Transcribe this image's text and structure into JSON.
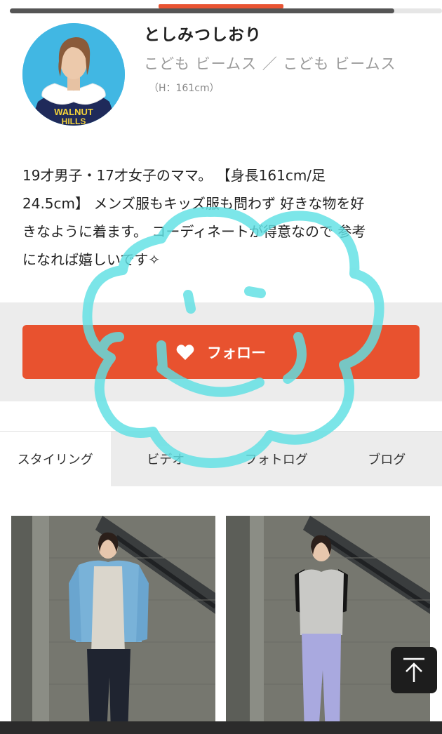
{
  "progress": {
    "fraction": 0.89,
    "accent_color": "#e95433"
  },
  "profile": {
    "name": "としみつしおり",
    "shop": "こども ビームス ／ こども ビームス",
    "height": "（H：161cm）",
    "avatar_shirt_text_1": "WALNUT",
    "avatar_shirt_text_2": "HILLS"
  },
  "bio": {
    "lines": [
      "19才男子・17才女子のママ。 【身長161cm/足",
      "24.5cm】 メンズ服もキッズ服も問わず 好きな物を好",
      "きなように着ます。 コーディネートが得意なので 参考",
      "になれば嬉しいです✧"
    ]
  },
  "follow": {
    "label": "フォロー",
    "icon": "heart-icon",
    "color": "#e8522f"
  },
  "tabs": [
    {
      "label": "スタイリング",
      "active": true
    },
    {
      "label": "ビデオ",
      "active": false
    },
    {
      "label": "フォトログ",
      "active": false
    },
    {
      "label": "ブログ",
      "active": false
    }
  ],
  "photos": [
    {
      "name": "styling-photo-1"
    },
    {
      "name": "styling-photo-2"
    }
  ],
  "scroll_top": {
    "icon": "arrow-up-to-top-icon"
  },
  "overlay": {
    "icon": "flower-doodle-icon",
    "color": "#5fe0e4"
  }
}
